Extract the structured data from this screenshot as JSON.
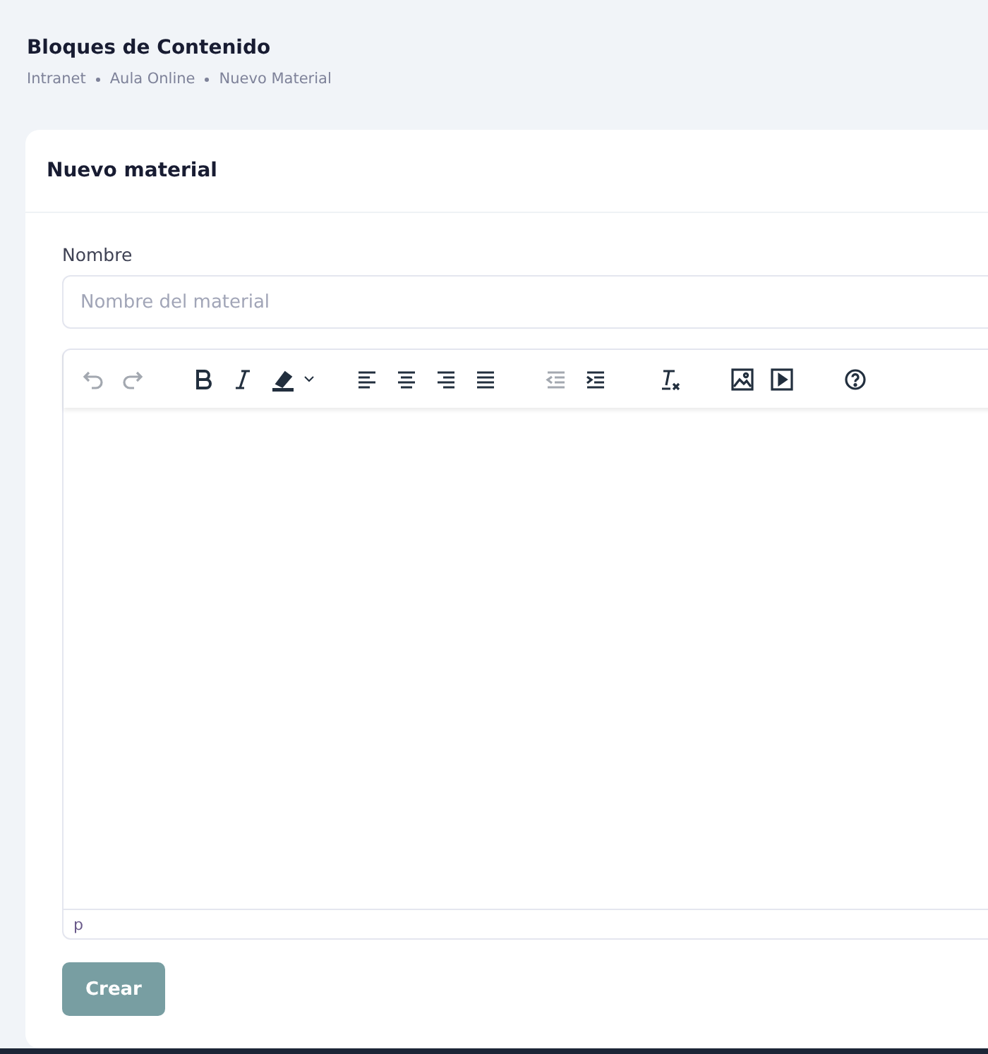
{
  "page": {
    "title": "Bloques de Contenido",
    "breadcrumb": [
      "Intranet",
      "Aula Online",
      "Nuevo Material"
    ]
  },
  "card": {
    "title": "Nuevo material"
  },
  "form": {
    "label": "Nombre",
    "placeholder": "Nombre del material"
  },
  "editor": {
    "toolbar": [
      {
        "kind": "undo",
        "disabled": true
      },
      {
        "kind": "redo",
        "disabled": true
      },
      {
        "kind": "bold",
        "disabled": false
      },
      {
        "kind": "italic",
        "disabled": false
      },
      {
        "kind": "highlight",
        "disabled": false
      },
      {
        "kind": "align-left",
        "disabled": false
      },
      {
        "kind": "align-center",
        "disabled": false
      },
      {
        "kind": "align-right",
        "disabled": false
      },
      {
        "kind": "justify",
        "disabled": false
      },
      {
        "kind": "outdent",
        "disabled": true
      },
      {
        "kind": "indent",
        "disabled": false
      },
      {
        "kind": "clear-format",
        "disabled": false
      },
      {
        "kind": "image",
        "disabled": false
      },
      {
        "kind": "video",
        "disabled": false
      },
      {
        "kind": "help",
        "disabled": false
      }
    ],
    "status_path": "p"
  },
  "submit": {
    "label": "Crear"
  }
}
